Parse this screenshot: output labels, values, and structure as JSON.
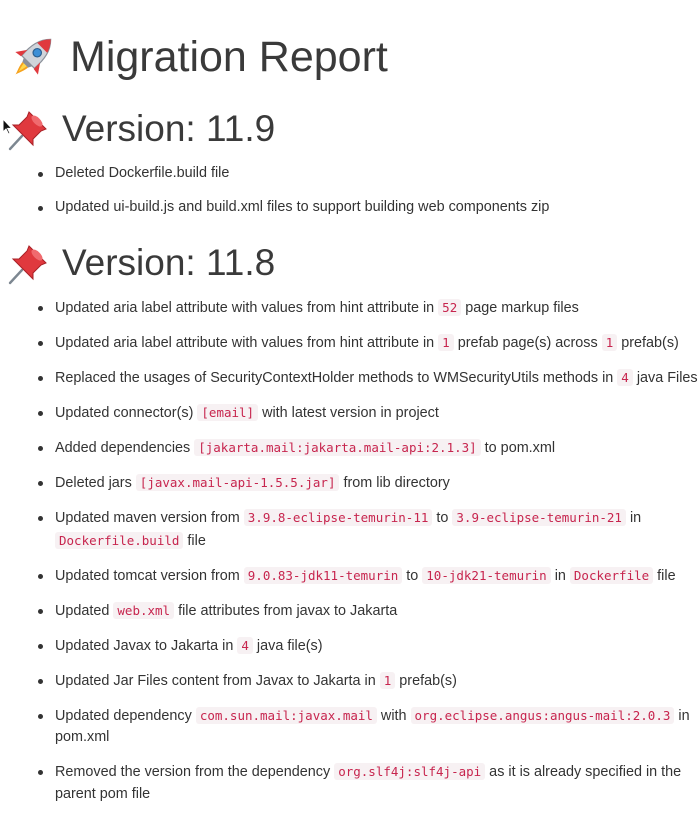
{
  "title": "Migration Report",
  "icons": {
    "title_icon": "rocket-icon",
    "section_icon": "pushpin-icon"
  },
  "sections": [
    {
      "heading": "Version: 11.9",
      "items": [
        {
          "parts": [
            {
              "t": "Deleted Dockerfile.build file"
            }
          ]
        },
        {
          "parts": [
            {
              "t": "Updated ui-build.js and build.xml files to support building web components zip"
            }
          ]
        }
      ]
    },
    {
      "heading": "Version: 11.8",
      "items": [
        {
          "parts": [
            {
              "t": "Updated aria label attribute with values from hint attribute in "
            },
            {
              "c": "52"
            },
            {
              "t": " page markup files"
            }
          ]
        },
        {
          "parts": [
            {
              "t": "Updated aria label attribute with values from hint attribute in "
            },
            {
              "c": "1"
            },
            {
              "t": " prefab page(s) across "
            },
            {
              "c": "1"
            },
            {
              "t": " prefab(s)"
            }
          ]
        },
        {
          "parts": [
            {
              "t": "Replaced the usages of SecurityContextHolder methods to WMSecurityUtils methods in "
            },
            {
              "c": "4"
            },
            {
              "t": " java Files"
            }
          ]
        },
        {
          "parts": [
            {
              "t": "Updated connector(s) "
            },
            {
              "c": "[email]"
            },
            {
              "t": " with latest version in project"
            }
          ]
        },
        {
          "parts": [
            {
              "t": "Added dependencies "
            },
            {
              "c": "[jakarta.mail:jakarta.mail-api:2.1.3]"
            },
            {
              "t": " to pom.xml"
            }
          ]
        },
        {
          "parts": [
            {
              "t": "Deleted jars "
            },
            {
              "c": "[javax.mail-api-1.5.5.jar]"
            },
            {
              "t": " from lib directory"
            }
          ]
        },
        {
          "parts": [
            {
              "t": "Updated maven version from "
            },
            {
              "c": "3.9.8-eclipse-temurin-11"
            },
            {
              "t": " to "
            },
            {
              "c": "3.9-eclipse-temurin-21"
            },
            {
              "t": " in "
            },
            {
              "c": "Dockerfile.build"
            },
            {
              "t": " file"
            }
          ]
        },
        {
          "parts": [
            {
              "t": "Updated tomcat version from "
            },
            {
              "c": "9.0.83-jdk11-temurin"
            },
            {
              "t": " to "
            },
            {
              "c": "10-jdk21-temurin"
            },
            {
              "t": " in "
            },
            {
              "c": "Dockerfile"
            },
            {
              "t": " file"
            }
          ]
        },
        {
          "parts": [
            {
              "t": "Updated "
            },
            {
              "c": "web.xml"
            },
            {
              "t": " file attributes from javax to Jakarta"
            }
          ]
        },
        {
          "parts": [
            {
              "t": "Updated Javax to Jakarta in "
            },
            {
              "c": "4"
            },
            {
              "t": " java file(s)"
            }
          ]
        },
        {
          "parts": [
            {
              "t": "Updated Jar Files content from Javax to Jakarta in "
            },
            {
              "c": "1"
            },
            {
              "t": " prefab(s)"
            }
          ]
        },
        {
          "parts": [
            {
              "t": "Updated dependency "
            },
            {
              "c": "com.sun.mail:javax.mail"
            },
            {
              "t": " with "
            },
            {
              "c": "org.eclipse.angus:angus-mail:2.0.3"
            },
            {
              "t": " in pom.xml"
            }
          ]
        },
        {
          "parts": [
            {
              "t": "Removed the version from the dependency "
            },
            {
              "c": "org.slf4j:slf4j-api"
            },
            {
              "t": " as it is already specified in the parent pom file"
            }
          ]
        }
      ]
    }
  ]
}
